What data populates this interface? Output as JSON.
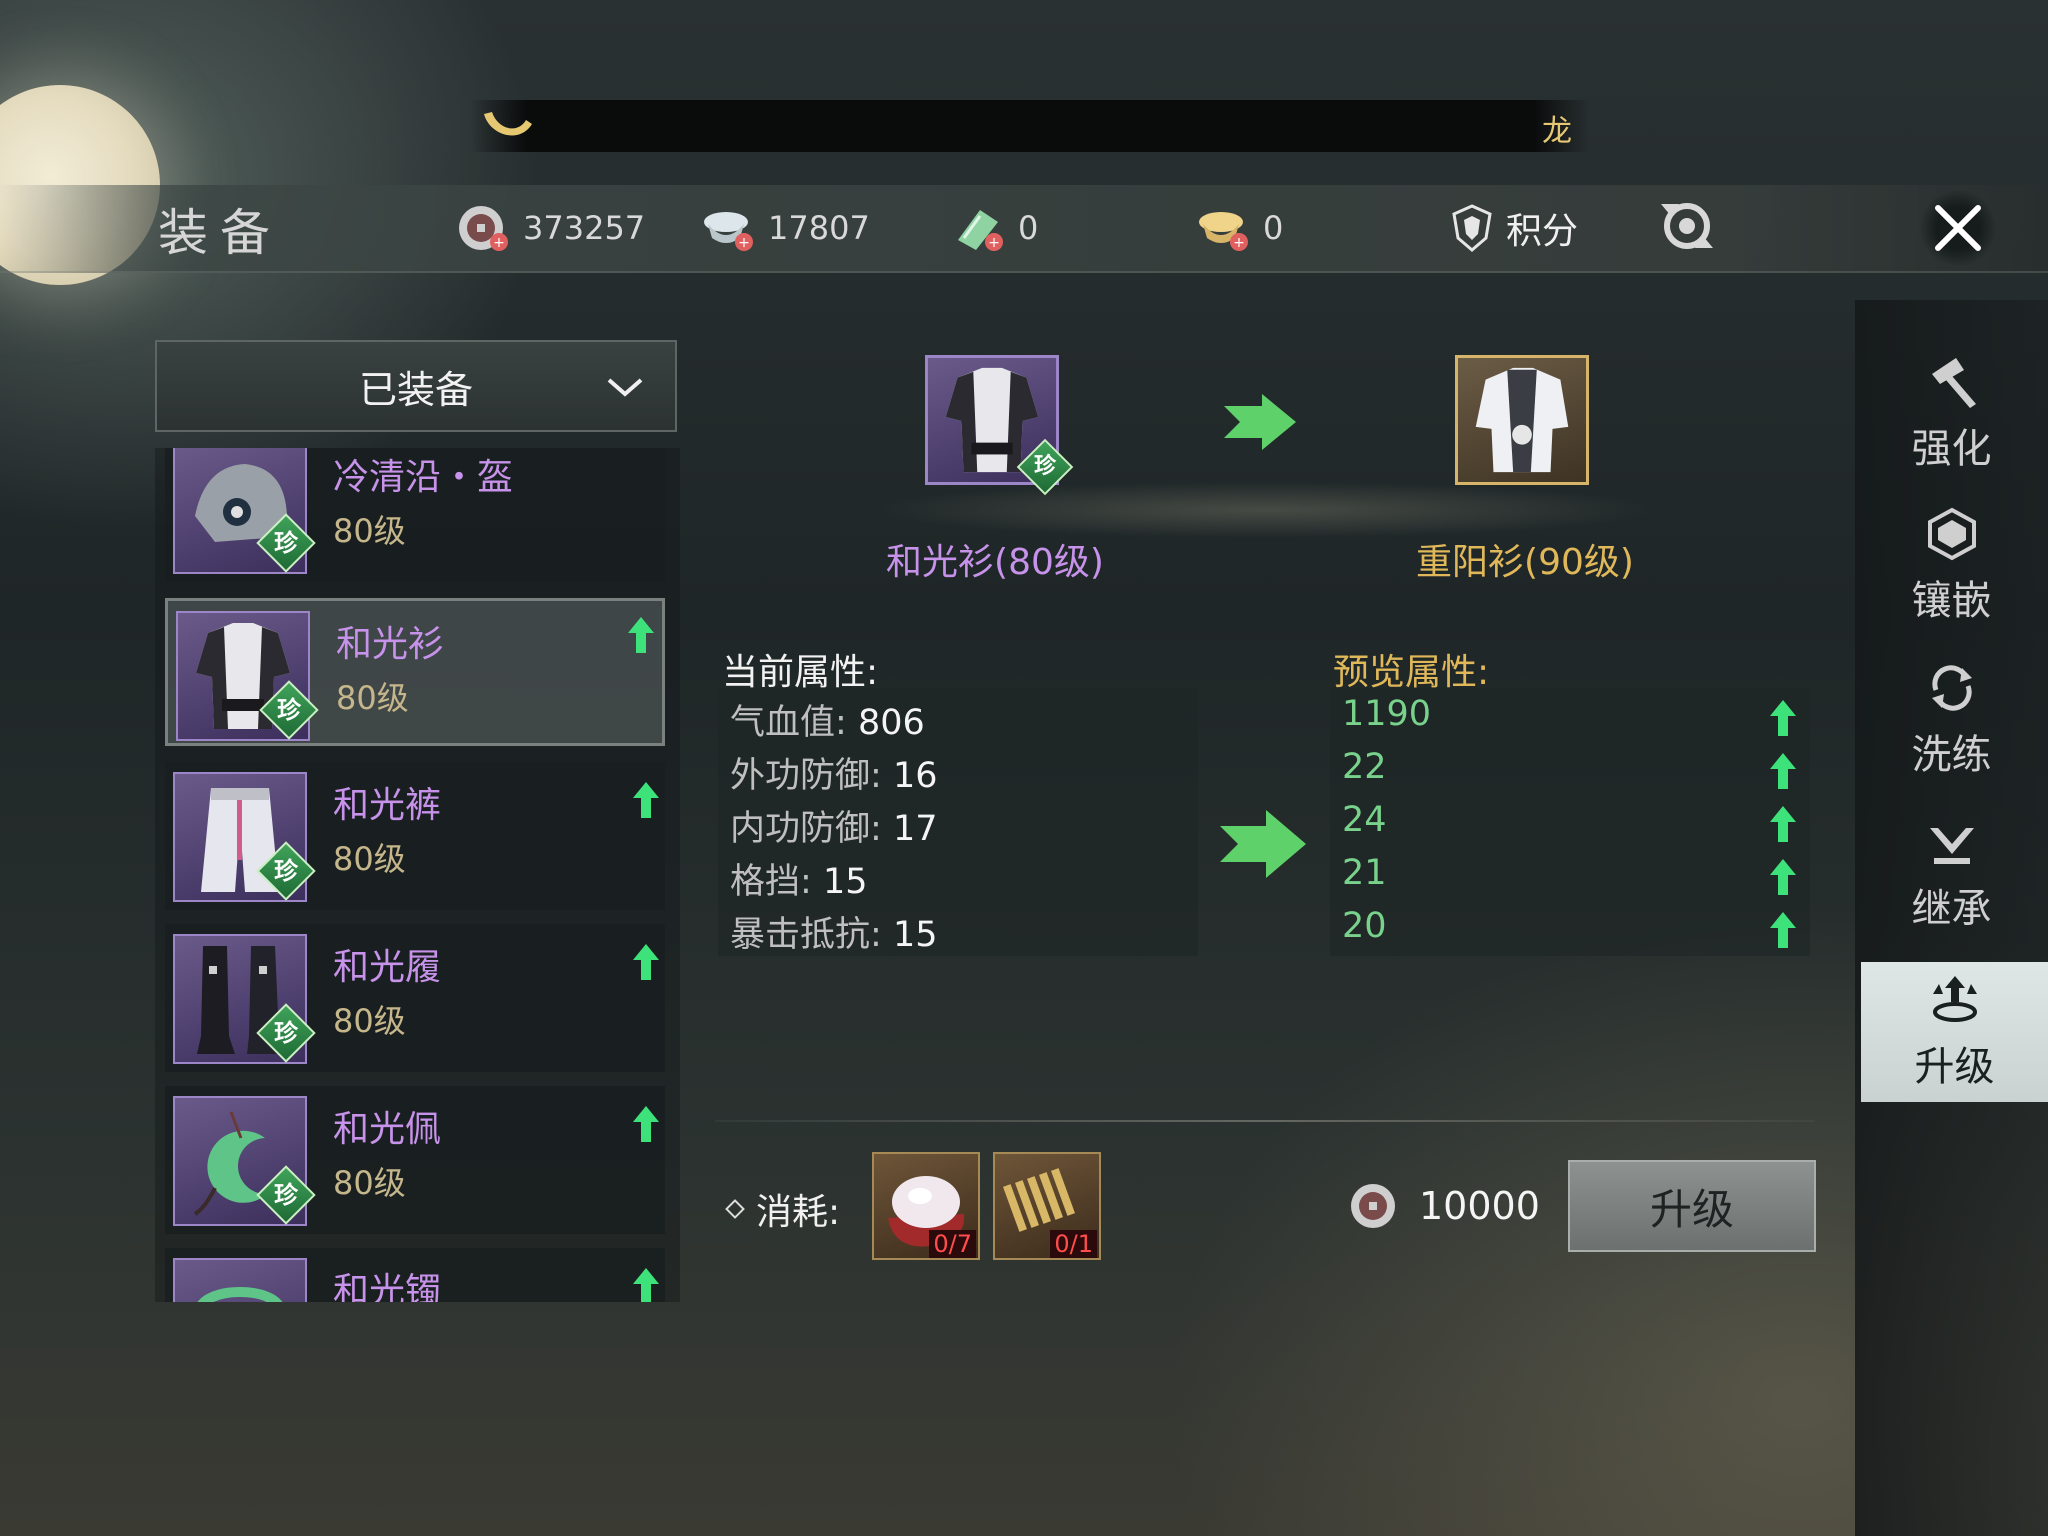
{
  "marquee": {
    "text": "龙"
  },
  "header": {
    "title": "装备"
  },
  "currencies": [
    {
      "icon": "coin-icon",
      "value": "373257"
    },
    {
      "icon": "silver-ingot-icon",
      "value": "17807"
    },
    {
      "icon": "jade-icon",
      "value": "0"
    },
    {
      "icon": "gold-ingot-icon",
      "value": "0"
    }
  ],
  "score": {
    "label": "积分"
  },
  "filter": {
    "label": "已装备"
  },
  "equipment_list": [
    {
      "name": "冷清沿・盔",
      "level": "80级",
      "badge": "珍"
    },
    {
      "name": "和光衫",
      "level": "80级",
      "badge": "珍"
    },
    {
      "name": "和光裤",
      "level": "80级",
      "badge": "珍"
    },
    {
      "name": "和光履",
      "level": "80级",
      "badge": "珍"
    },
    {
      "name": "和光佩",
      "level": "80级",
      "badge": "珍"
    },
    {
      "name": "和光镯",
      "level": "",
      "badge": ""
    }
  ],
  "upgrade": {
    "current_item": "和光衫(80级)",
    "target_item": "重阳衫(90级)",
    "current_badge": "珍",
    "current_attr_title": "当前属性:",
    "preview_attr_title": "预览属性:",
    "current_attrs": [
      {
        "label": "气血值:",
        "value": "806"
      },
      {
        "label": "外功防御:",
        "value": "16"
      },
      {
        "label": "内功防御:",
        "value": "17"
      },
      {
        "label": "格挡:",
        "value": "15"
      },
      {
        "label": "暴击抵抗:",
        "value": "15"
      }
    ],
    "preview_attrs": [
      "1190",
      "22",
      "24",
      "21",
      "20"
    ],
    "cost_label": "消耗:",
    "materials": [
      {
        "name": "jade-stone-material",
        "count": "0/7"
      },
      {
        "name": "bamboo-scroll-material",
        "count": "0/1"
      }
    ],
    "price": "10000",
    "button": "升级"
  },
  "nav": [
    {
      "label": "强化",
      "icon": "hammer-icon"
    },
    {
      "label": "镶嵌",
      "icon": "gem-icon"
    },
    {
      "label": "洗练",
      "icon": "refine-icon"
    },
    {
      "label": "继承",
      "icon": "inherit-icon"
    },
    {
      "label": "升级",
      "icon": "upgrade-icon"
    }
  ],
  "colors": {
    "epic_purple": "#c792ea",
    "gold": "#e0b85a",
    "green": "#78d28c"
  }
}
